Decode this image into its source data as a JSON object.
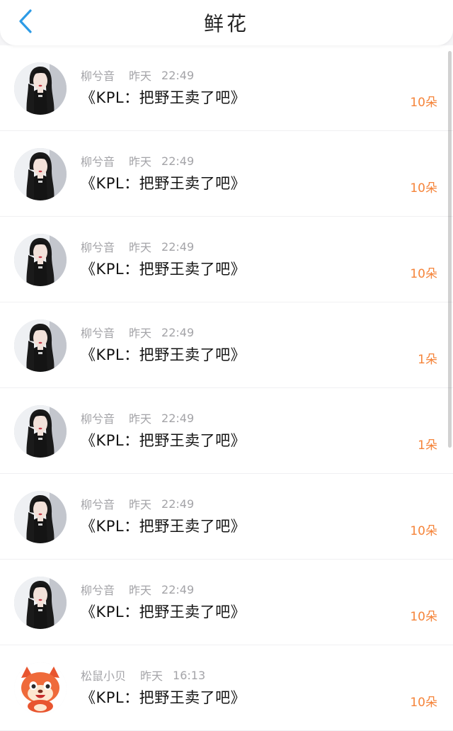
{
  "header": {
    "title": "鲜花",
    "back_icon": "chevron-left-icon",
    "accent_color": "#2d9be6"
  },
  "count_color": "#f5843a",
  "gifts": [
    {
      "sender": "柳兮音",
      "day": "昨天",
      "time": "22:49",
      "title": "《KPL：把野王卖了吧》",
      "count": "10朵",
      "avatar": "woman-portrait"
    },
    {
      "sender": "柳兮音",
      "day": "昨天",
      "time": "22:49",
      "title": "《KPL：把野王卖了吧》",
      "count": "10朵",
      "avatar": "woman-portrait"
    },
    {
      "sender": "柳兮音",
      "day": "昨天",
      "time": "22:49",
      "title": "《KPL：把野王卖了吧》",
      "count": "10朵",
      "avatar": "woman-portrait"
    },
    {
      "sender": "柳兮音",
      "day": "昨天",
      "time": "22:49",
      "title": "《KPL：把野王卖了吧》",
      "count": "1朵",
      "avatar": "woman-portrait"
    },
    {
      "sender": "柳兮音",
      "day": "昨天",
      "time": "22:49",
      "title": "《KPL：把野王卖了吧》",
      "count": "1朵",
      "avatar": "woman-portrait"
    },
    {
      "sender": "柳兮音",
      "day": "昨天",
      "time": "22:49",
      "title": "《KPL：把野王卖了吧》",
      "count": "10朵",
      "avatar": "woman-portrait"
    },
    {
      "sender": "柳兮音",
      "day": "昨天",
      "time": "22:49",
      "title": "《KPL：把野王卖了吧》",
      "count": "10朵",
      "avatar": "woman-portrait"
    },
    {
      "sender": "松鼠小贝",
      "day": "昨天",
      "time": "16:13",
      "title": "《KPL：把野王卖了吧》",
      "count": "10朵",
      "avatar": "cartoon-fox"
    }
  ]
}
